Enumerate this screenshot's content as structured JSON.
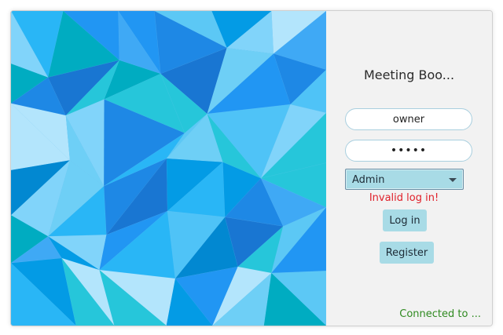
{
  "app": {
    "title": "Meeting Boo..."
  },
  "login": {
    "username_value": "owner",
    "password_value": "•••••",
    "role_selected": "Admin",
    "error_message": "Invalid log in!",
    "login_label": "Log in",
    "register_label": "Register"
  },
  "status": {
    "text": "Connected to ..."
  },
  "colors": {
    "button_bg": "#a8dbe6",
    "error": "#e0202a",
    "status": "#2f8a20",
    "art_base": "#29a8ee"
  }
}
